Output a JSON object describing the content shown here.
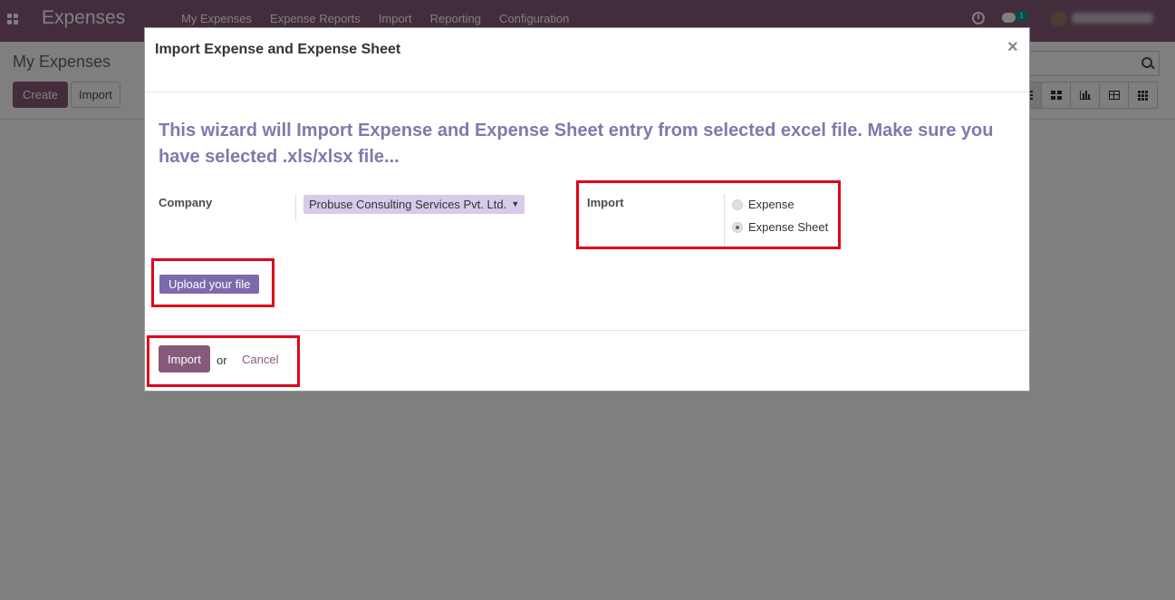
{
  "navbar": {
    "app_title": "Expenses",
    "menu": [
      "My Expenses",
      "Expense Reports",
      "Import",
      "Reporting",
      "Configuration"
    ],
    "chat_count": "1"
  },
  "control_panel": {
    "breadcrumb": "My Expenses",
    "create_label": "Create",
    "import_label": "Import"
  },
  "modal": {
    "title": "Import Expense and Expense Sheet",
    "close": "×",
    "info": "This wizard will Import Expense and Expense Sheet entry from selected excel file. Make sure you have selected .xls/xlsx file...",
    "company_label": "Company",
    "company_value": "Probuse Consulting Services Pvt. Ltd.",
    "import_label": "Import",
    "import_options": [
      "Expense",
      "Expense Sheet"
    ],
    "import_selected": "Expense Sheet",
    "upload_label": "Upload your file",
    "footer": {
      "import_button": "Import",
      "or_text": "or",
      "cancel_link": "Cancel"
    }
  },
  "colors": {
    "brand": "#875a7b",
    "info_text": "#7c7bad",
    "highlight": "#e0001a"
  }
}
